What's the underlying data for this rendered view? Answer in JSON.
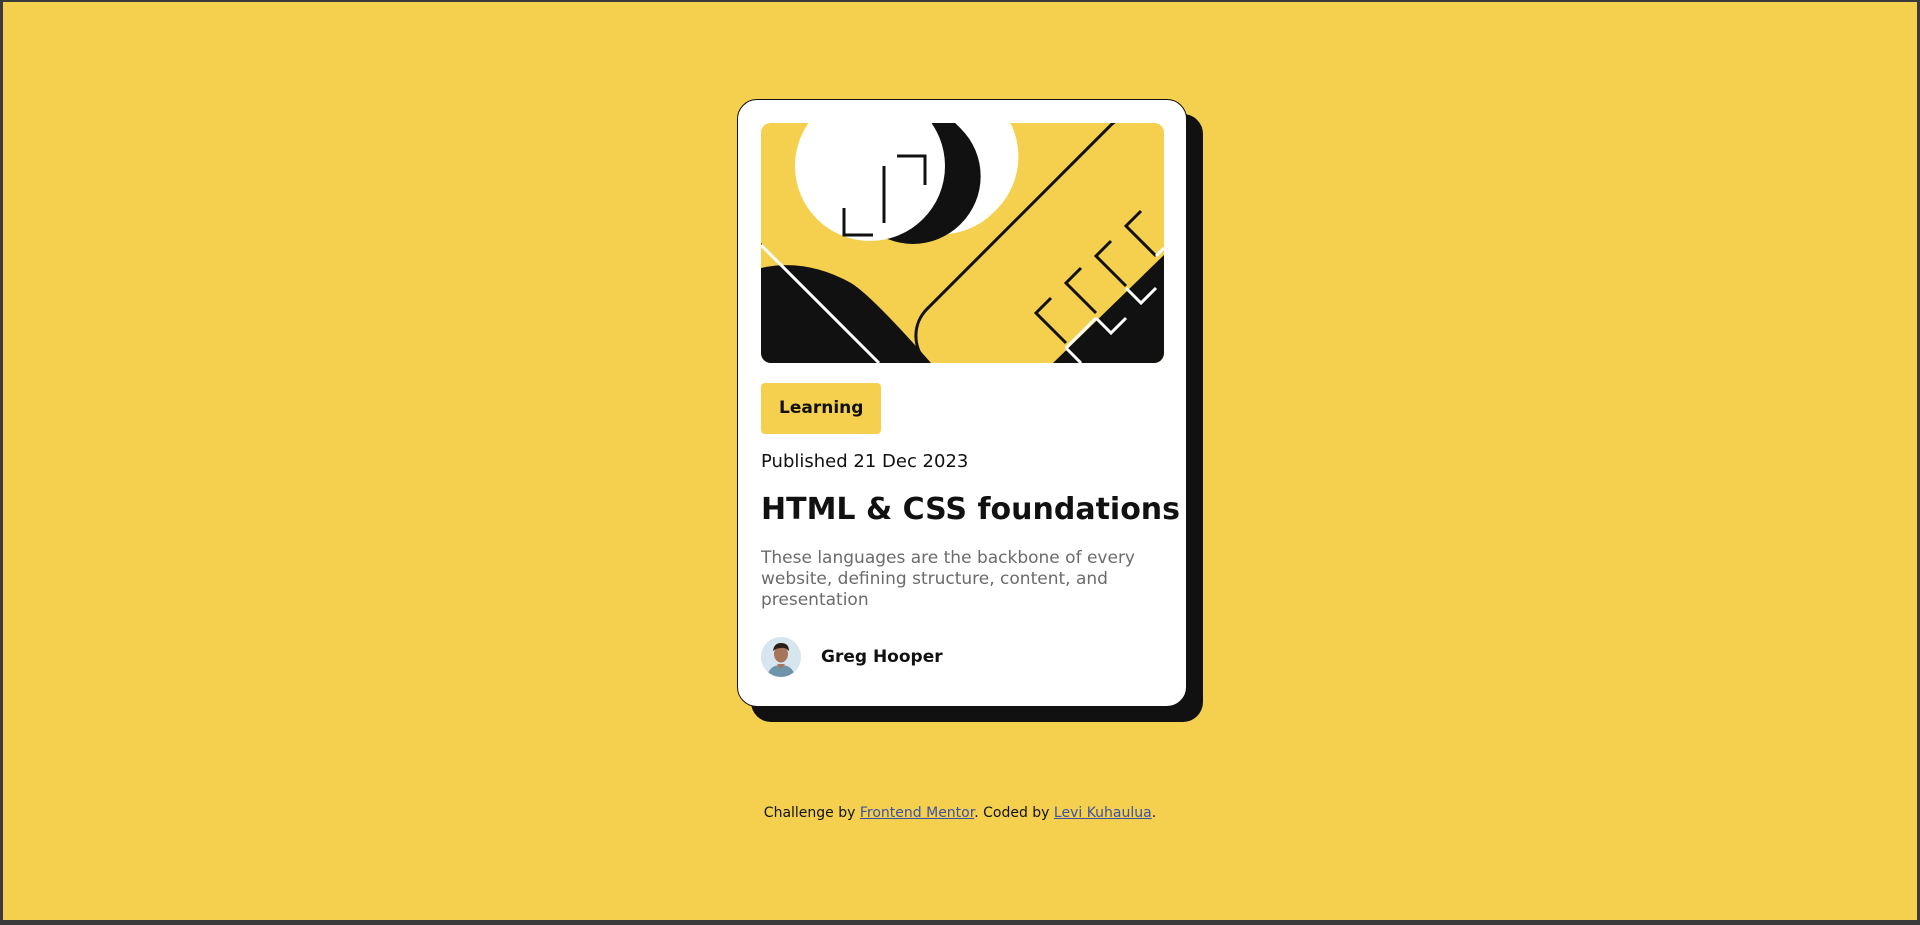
{
  "card": {
    "tag": "Learning",
    "published": "Published 21 Dec 2023",
    "title": "HTML & CSS foundations",
    "description": "These languages are the backbone of every website, defining structure, content, and presentation",
    "author": "Greg Hooper"
  },
  "footer": {
    "prefix": "Challenge by ",
    "mentor_link": "Frontend Mentor",
    "middle": ". Coded by ",
    "coder_link": "Levi Kuhaulua",
    "suffix": "."
  },
  "colors": {
    "background": "#f4d04e",
    "card": "#ffffff",
    "ink": "#111111",
    "muted_text": "#6b6b6b",
    "link": "#3e52a3"
  },
  "icons": {
    "hero": "abstract-illustration",
    "avatar": "author-avatar"
  }
}
